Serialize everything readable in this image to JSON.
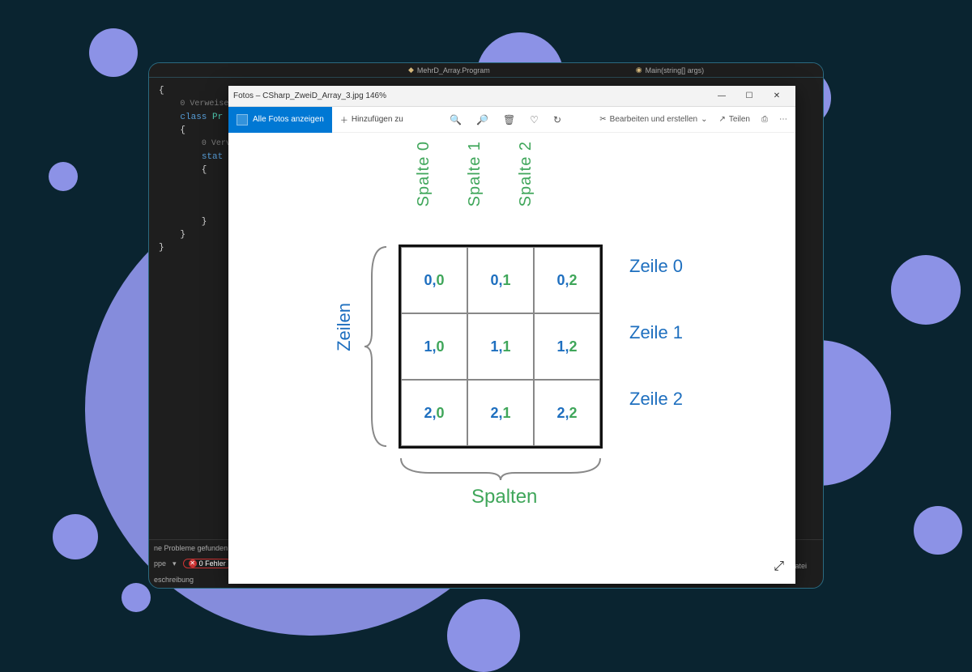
{
  "vs": {
    "crumb1": "MehrD_Array.Program",
    "crumb2": "Main(string[] args)",
    "refs": "0 Verweise",
    "class_kw": "class",
    "class_name": "Pr",
    "refs2": "0 Verv",
    "static_kw": "stat",
    "status": "ne Probleme gefunden",
    "errors_label": "0 Fehler",
    "dropdown": "ppe",
    "desc": "eschreibung",
    "datei": "Datei"
  },
  "photos": {
    "title": "Fotos – CSharp_ZweiD_Array_3.jpg   146%",
    "blue_button": "Alle Fotos anzeigen",
    "add": "Hinzufügen zu",
    "edit": "Bearbeiten und erstellen",
    "share": "Teilen"
  },
  "diagram": {
    "col_labels": [
      "Spalte 0",
      "Spalte 1",
      "Spalte 2"
    ],
    "row_labels": [
      "Zeile 0",
      "Zeile 1",
      "Zeile 2"
    ],
    "zeilen": "Zeilen",
    "spalten": "Spalten",
    "cells": [
      [
        {
          "r": "0",
          "c": "0"
        },
        {
          "r": "0",
          "c": "1"
        },
        {
          "r": "0",
          "c": "2"
        }
      ],
      [
        {
          "r": "1",
          "c": "0"
        },
        {
          "r": "1",
          "c": "1"
        },
        {
          "r": "1",
          "c": "2"
        }
      ],
      [
        {
          "r": "2",
          "c": "0"
        },
        {
          "r": "2",
          "c": "1"
        },
        {
          "r": "2",
          "c": "2"
        }
      ]
    ]
  }
}
